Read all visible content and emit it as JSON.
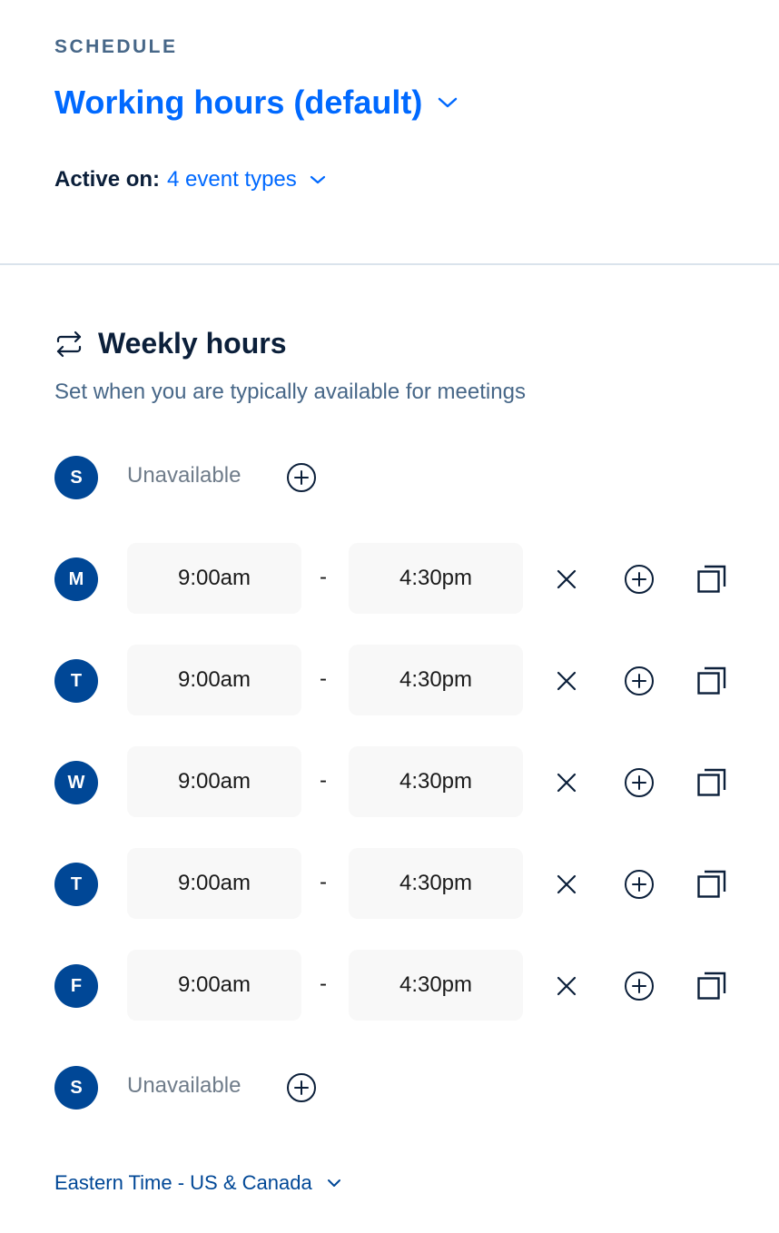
{
  "header": {
    "eyebrow": "SCHEDULE",
    "schedule_name": "Working hours (default)",
    "active_on_label": "Active on:",
    "active_on_value": "4 event types"
  },
  "weekly": {
    "title": "Weekly hours",
    "subtitle": "Set when you are typically available for meetings",
    "dash": "-",
    "days": [
      {
        "letter": "S",
        "unavailable": "Unavailable"
      },
      {
        "letter": "M",
        "start": "9:00am",
        "end": "4:30pm"
      },
      {
        "letter": "T",
        "start": "9:00am",
        "end": "4:30pm"
      },
      {
        "letter": "W",
        "start": "9:00am",
        "end": "4:30pm"
      },
      {
        "letter": "T",
        "start": "9:00am",
        "end": "4:30pm"
      },
      {
        "letter": "F",
        "start": "9:00am",
        "end": "4:30pm"
      },
      {
        "letter": "S",
        "unavailable": "Unavailable"
      }
    ]
  },
  "timezone": "Eastern Time - US & Canada",
  "colors": {
    "accent": "#0069ff",
    "day_circle": "#004796",
    "muted": "#476788",
    "time_box_bg": "#f8f8f8"
  }
}
